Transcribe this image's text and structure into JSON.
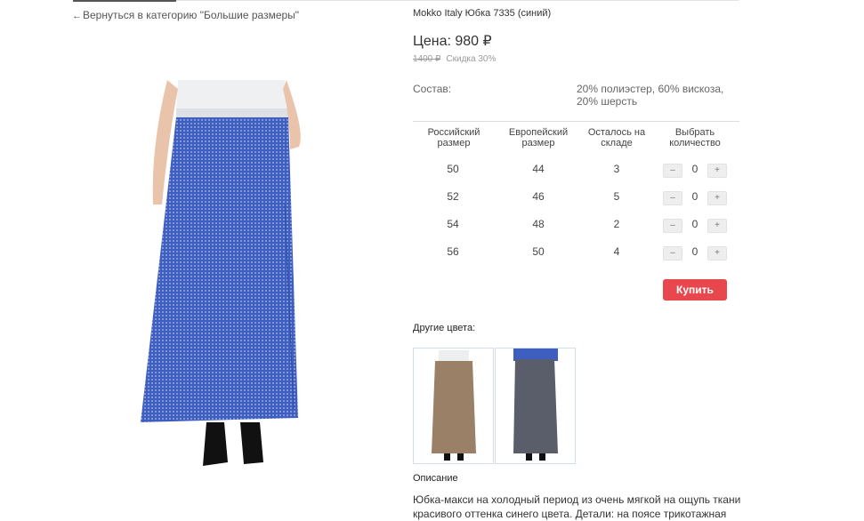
{
  "nav": {
    "back_arrow": "←",
    "back_text": "Вернуться в категорию \"Большие размеры\""
  },
  "product": {
    "title": "Mokko Italy Юбка 7335 (синий)",
    "price": "Цена: 980 ₽",
    "old_price": "1400 ₽",
    "discount": "Скидка 30%",
    "composition_label": "Состав:",
    "composition_value": "20% полиэстер, 60% вискоза, 20% шерсть",
    "image_icon": "skirt-photo",
    "skirt_color": "#3f5fc0"
  },
  "sizes": {
    "headers": [
      "Российский размер",
      "Европейский размер",
      "Осталось на складе",
      "Выбрать количество"
    ],
    "rows": [
      {
        "ru": "50",
        "eu": "44",
        "stock": "3",
        "qty": "0"
      },
      {
        "ru": "52",
        "eu": "46",
        "stock": "5",
        "qty": "0"
      },
      {
        "ru": "54",
        "eu": "48",
        "stock": "2",
        "qty": "0"
      },
      {
        "ru": "56",
        "eu": "50",
        "stock": "4",
        "qty": "0"
      }
    ],
    "minus": "–",
    "plus": "+"
  },
  "buy_label": "Купить",
  "accent_color": "#e8474e",
  "other_colors": {
    "label": "Другие цвета:",
    "items": [
      {
        "color": "#9b8068"
      },
      {
        "color": "#5a5e6a"
      }
    ]
  },
  "description": {
    "label": "Описание",
    "text": "Юбка-макси на холодный период из очень мягкой на ощупь ткани красивого оттенка синего цвета. Детали: на поясе трикотажная"
  }
}
